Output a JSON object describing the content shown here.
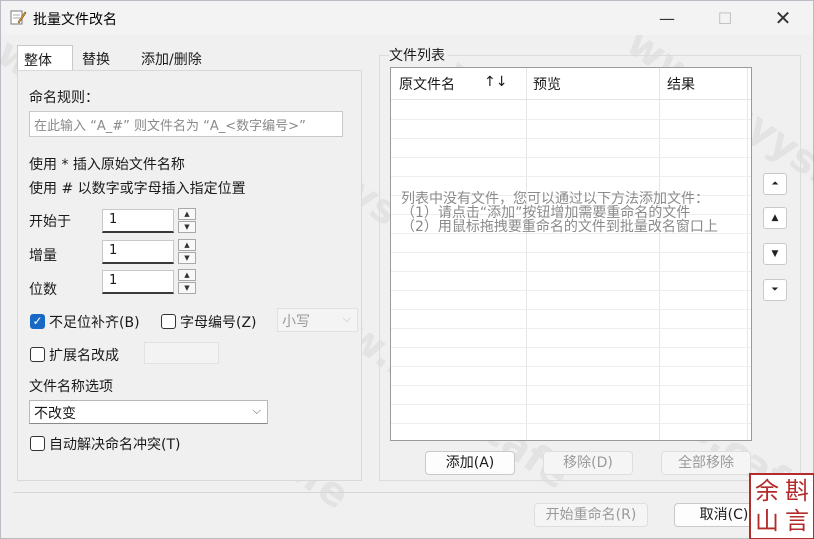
{
  "window": {
    "title": "批量文件改名",
    "min_glyph": "—",
    "max_glyph": "☐",
    "close_glyph": "✕"
  },
  "tabs": [
    {
      "label": "整体",
      "active": true
    },
    {
      "label": "替换",
      "active": false
    },
    {
      "label": "添加/删除",
      "active": false
    }
  ],
  "naming": {
    "rule_label": "命名规则：",
    "rule_placeholder": "在此输入 “A_#” 则文件名为 “A_<数字编号>”",
    "hint1": "使用 * 插入原始文件名称",
    "hint2": "使用 # 以数字或字母插入指定位置",
    "start_label": "开始于",
    "start_value": "1",
    "step_label": "增量",
    "step_value": "1",
    "digits_label": "位数",
    "digits_value": "1",
    "pad_label": "不足位补齐(B)",
    "pad_checked": true,
    "letter_label": "字母编号(Z)",
    "letter_checked": false,
    "case_value": "小写",
    "ext_label": "扩展名改成",
    "ext_checked": false,
    "filename_opt_label": "文件名称选项",
    "filename_opt_value": "不改变",
    "conflict_label": "自动解决命名冲突(T)",
    "conflict_checked": false
  },
  "file_list": {
    "group_title": "文件列表",
    "columns": [
      "原文件名",
      "预览",
      "结果"
    ],
    "sort_glyph": "↑↓",
    "empty_line1": "列表中没有文件，您可以通过以下方法添加文件：",
    "empty_line2": "（1）请点击“添加”按钮增加需要重命名的文件",
    "empty_line3": "（2）用鼠标拖拽要重命名的文件到批量改名窗口上"
  },
  "move_buttons": {
    "top": "⏶",
    "up": "▲",
    "down": "▼",
    "bottom": "⏷"
  },
  "buttons": {
    "add": "添加(A)",
    "remove": "移除(D)",
    "remove_all": "全部移除",
    "start": "开始重命名(R)",
    "cancel": "取消(C)"
  },
  "watermark": "www.syys.cafe",
  "seal_chars": [
    "余",
    "斟",
    "山",
    "言"
  ]
}
